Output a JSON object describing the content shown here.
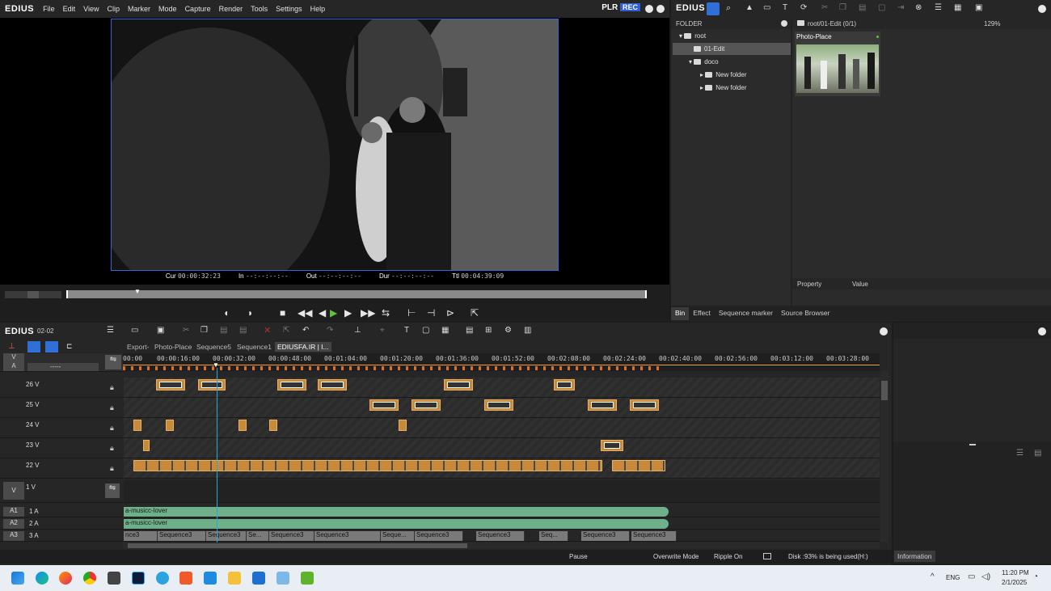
{
  "app": {
    "logo": "EDIUS"
  },
  "menu": [
    "File",
    "Edit",
    "View",
    "Clip",
    "Marker",
    "Mode",
    "Capture",
    "Render",
    "Tools",
    "Settings",
    "Help"
  ],
  "player": {
    "plr": "PLR",
    "rec": "REC",
    "timecodes": [
      {
        "label": "Cur",
        "value": "00:00:32:23"
      },
      {
        "label": "In",
        "value": "--:--:--:--"
      },
      {
        "label": "Out",
        "value": "--:--:--:--"
      },
      {
        "label": "Dur",
        "value": "--:--:--:--"
      },
      {
        "label": "Ttl",
        "value": "00:04:39:09"
      }
    ]
  },
  "bin": {
    "logo": "EDIUS",
    "folder_header": "FOLDER",
    "path": "root/01-Edit (0/1)",
    "zoom": "129%",
    "tree": [
      {
        "label": "root",
        "level": 0
      },
      {
        "label": "01-Edit",
        "level": 1,
        "selected": true
      },
      {
        "label": "doco",
        "level": 1
      },
      {
        "label": "New folder",
        "level": 2
      },
      {
        "label": "New folder",
        "level": 2
      }
    ],
    "clip_name": "Photo-Place",
    "property_header": "Property",
    "value_header": "Value",
    "tabs": [
      "Bin",
      "Effect",
      "Sequence marker",
      "Source Browser"
    ]
  },
  "timeline": {
    "logo": "EDIUS",
    "project": "02-02",
    "sequence_tabs": [
      "Export-",
      "Photo-Place",
      "Sequence5",
      "Sequence1",
      "EDIUSFA.IR | I..."
    ],
    "ruler": [
      "00:00",
      "00:00:16:00",
      "00:00:32:00",
      "00:00:48:00",
      "00:01:04:00",
      "00:01:20:00",
      "00:01:36:00",
      "00:01:52:00",
      "00:02:08:00",
      "00:02:24:00",
      "00:02:40:00",
      "00:02:56:00",
      "00:03:12:00",
      "00:03:28:00"
    ],
    "dropdown_value": "-----",
    "tracks": [
      {
        "id": "26 V"
      },
      {
        "id": "25 V"
      },
      {
        "id": "24 V"
      },
      {
        "id": "23 V"
      },
      {
        "id": "22 V"
      },
      {
        "id": "1 V",
        "type": "V"
      }
    ],
    "audio_tracks": [
      {
        "tag": "A1",
        "name": "1 A",
        "clip": "a-musicc-lover"
      },
      {
        "tag": "A2",
        "name": "2 A",
        "clip": "a-musicc-lover"
      },
      {
        "tag": "A3",
        "name": "3 A"
      }
    ],
    "seq_clips": [
      "nce3",
      "Sequence3",
      "Sequence3",
      "Se...",
      "Sequence3",
      "Sequence3",
      "Seque...",
      "Sequence3",
      "Sequence3",
      "Seq...",
      "Sequence3",
      "Sequence3"
    ],
    "va_labels": [
      "V",
      "A"
    ]
  },
  "status": {
    "state": "Pause",
    "mode": "Overwrite Mode",
    "ripple": "Ripple On",
    "disk": "Disk :93% is being used(H:)"
  },
  "info_tab": "Information",
  "taskbar": {
    "lang": "ENG",
    "time": "11:20 PM",
    "date": "2/1/2025"
  }
}
